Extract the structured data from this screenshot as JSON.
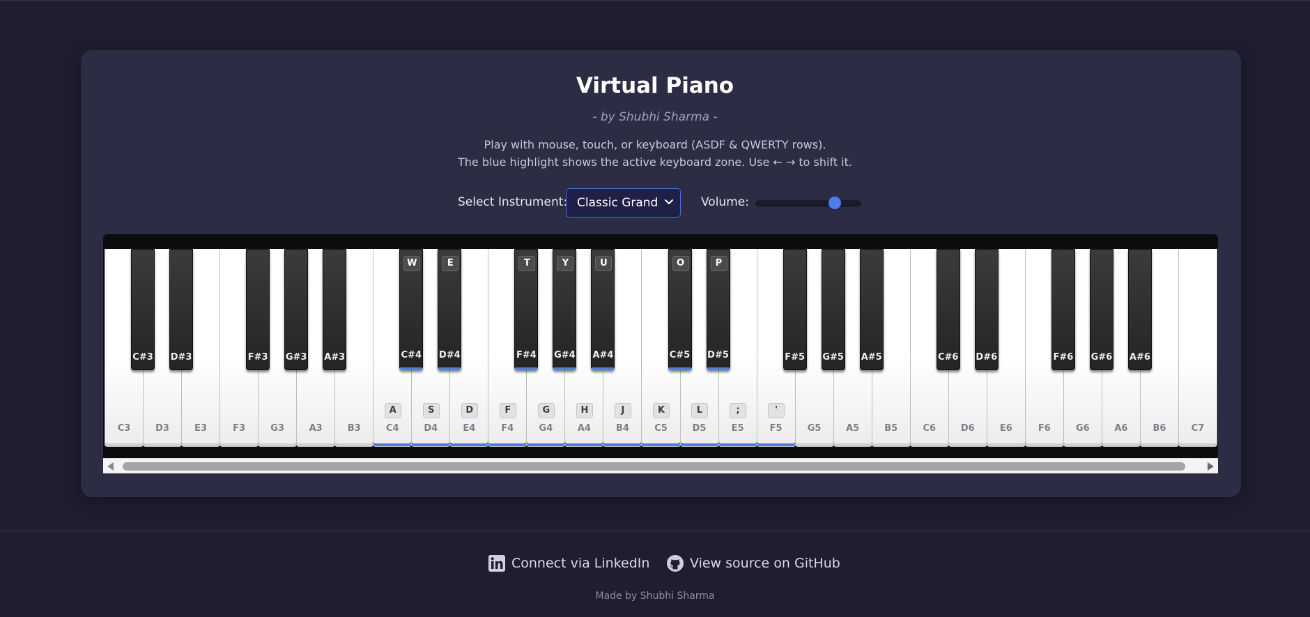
{
  "header": {
    "title": "Virtual Piano",
    "subtitle": "- by Shubhi Sharma -",
    "description_line1": "Play with mouse, touch, or keyboard (ASDF & QWERTY rows).",
    "description_line2": "The blue highlight shows the active keyboard zone. Use ← → to shift it."
  },
  "controls": {
    "instrument_label": "Select Instrument:",
    "instrument_value": "Classic Grand",
    "volume_label": "Volume:",
    "volume_level": 0.75
  },
  "piano": {
    "accent_color": "#4d7ee6",
    "white_keys": [
      {
        "note": "C3",
        "key": "",
        "active": false
      },
      {
        "note": "D3",
        "key": "",
        "active": false
      },
      {
        "note": "E3",
        "key": "",
        "active": false
      },
      {
        "note": "F3",
        "key": "",
        "active": false
      },
      {
        "note": "G3",
        "key": "",
        "active": false
      },
      {
        "note": "A3",
        "key": "",
        "active": false
      },
      {
        "note": "B3",
        "key": "",
        "active": false
      },
      {
        "note": "C4",
        "key": "A",
        "active": true
      },
      {
        "note": "D4",
        "key": "S",
        "active": true
      },
      {
        "note": "E4",
        "key": "D",
        "active": true
      },
      {
        "note": "F4",
        "key": "F",
        "active": true
      },
      {
        "note": "G4",
        "key": "G",
        "active": true
      },
      {
        "note": "A4",
        "key": "H",
        "active": true
      },
      {
        "note": "B4",
        "key": "J",
        "active": true
      },
      {
        "note": "C5",
        "key": "K",
        "active": true
      },
      {
        "note": "D5",
        "key": "L",
        "active": true
      },
      {
        "note": "E5",
        "key": ";",
        "active": true
      },
      {
        "note": "F5",
        "key": "'",
        "active": true
      },
      {
        "note": "G5",
        "key": "",
        "active": false
      },
      {
        "note": "A5",
        "key": "",
        "active": false
      },
      {
        "note": "B5",
        "key": "",
        "active": false
      },
      {
        "note": "C6",
        "key": "",
        "active": false
      },
      {
        "note": "D6",
        "key": "",
        "active": false
      },
      {
        "note": "E6",
        "key": "",
        "active": false
      },
      {
        "note": "F6",
        "key": "",
        "active": false
      },
      {
        "note": "G6",
        "key": "",
        "active": false
      },
      {
        "note": "A6",
        "key": "",
        "active": false
      },
      {
        "note": "B6",
        "key": "",
        "active": false
      },
      {
        "note": "C7",
        "key": "",
        "active": false
      }
    ],
    "black_keys": [
      {
        "note": "C#3",
        "key": "",
        "active": false
      },
      {
        "note": "D#3",
        "key": "",
        "active": false
      },
      {
        "note": "F#3",
        "key": "",
        "active": false
      },
      {
        "note": "G#3",
        "key": "",
        "active": false
      },
      {
        "note": "A#3",
        "key": "",
        "active": false
      },
      {
        "note": "C#4",
        "key": "W",
        "active": true
      },
      {
        "note": "D#4",
        "key": "E",
        "active": true
      },
      {
        "note": "F#4",
        "key": "T",
        "active": true
      },
      {
        "note": "G#4",
        "key": "Y",
        "active": true
      },
      {
        "note": "A#4",
        "key": "U",
        "active": true
      },
      {
        "note": "C#5",
        "key": "O",
        "active": true
      },
      {
        "note": "D#5",
        "key": "P",
        "active": true
      },
      {
        "note": "F#5",
        "key": "",
        "active": false
      },
      {
        "note": "G#5",
        "key": "",
        "active": false
      },
      {
        "note": "A#5",
        "key": "",
        "active": false
      },
      {
        "note": "C#6",
        "key": "",
        "active": false
      },
      {
        "note": "D#6",
        "key": "",
        "active": false
      },
      {
        "note": "F#6",
        "key": "",
        "active": false
      },
      {
        "note": "G#6",
        "key": "",
        "active": false
      },
      {
        "note": "A#6",
        "key": "",
        "active": false
      }
    ]
  },
  "footer": {
    "linkedin_label": "Connect via LinkedIn",
    "github_label": "View source on GitHub",
    "made_by": "Made by Shubhi Sharma"
  }
}
